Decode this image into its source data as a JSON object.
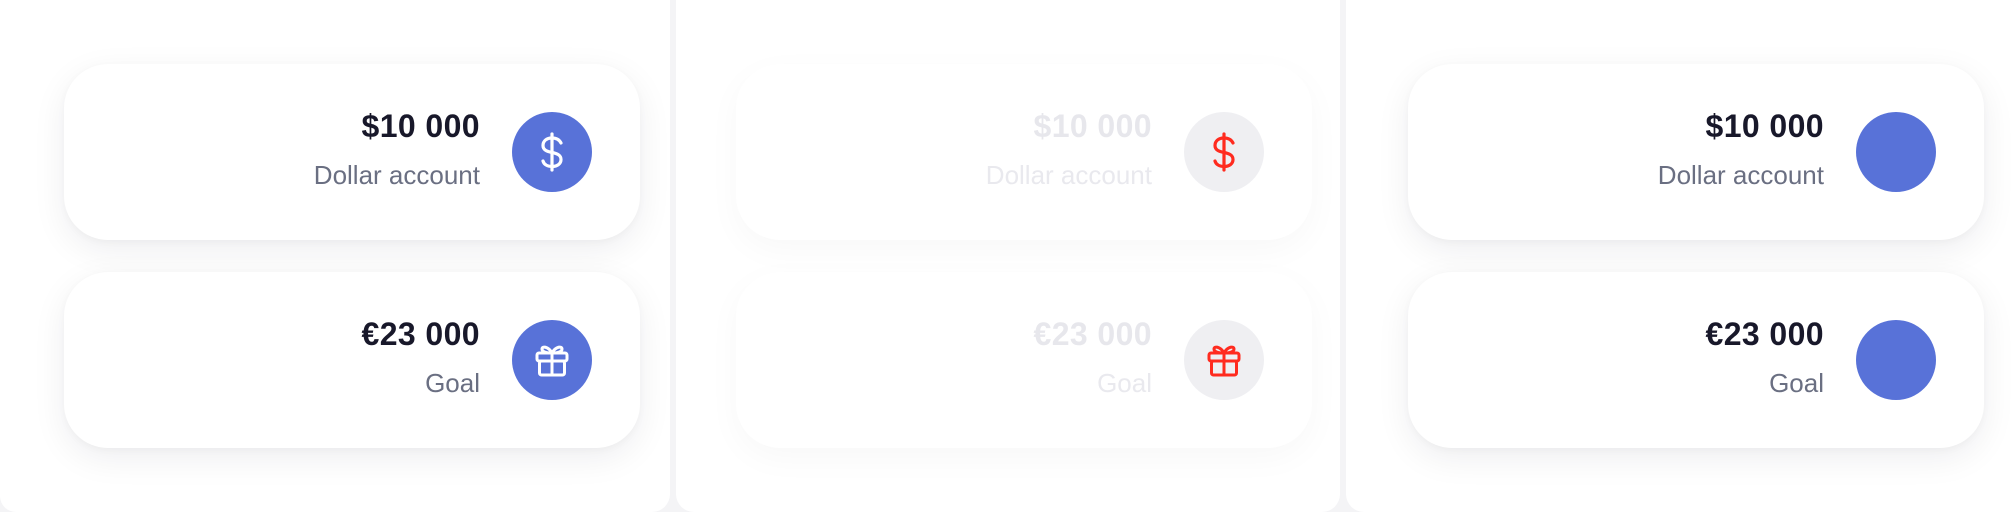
{
  "colors": {
    "accent": "#5872d8",
    "icon_red": "#ff2b1f",
    "text_primary": "#18182a",
    "text_secondary": "#6a6f82"
  },
  "columns": [
    {
      "variant": "normal",
      "cards": [
        {
          "amount": "$10 000",
          "label": "Dollar account",
          "icon": "dollar-icon"
        },
        {
          "amount": "€23 000",
          "label": "Goal",
          "icon": "gift-icon"
        }
      ]
    },
    {
      "variant": "faded",
      "cards": [
        {
          "amount": "$10 000",
          "label": "Dollar account",
          "icon": "dollar-icon"
        },
        {
          "amount": "€23 000",
          "label": "Goal",
          "icon": "gift-icon"
        }
      ]
    },
    {
      "variant": "no-icon",
      "cards": [
        {
          "amount": "$10 000",
          "label": "Dollar account",
          "icon": "blank-circle-icon"
        },
        {
          "amount": "€23 000",
          "label": "Goal",
          "icon": "blank-circle-icon"
        }
      ]
    }
  ]
}
